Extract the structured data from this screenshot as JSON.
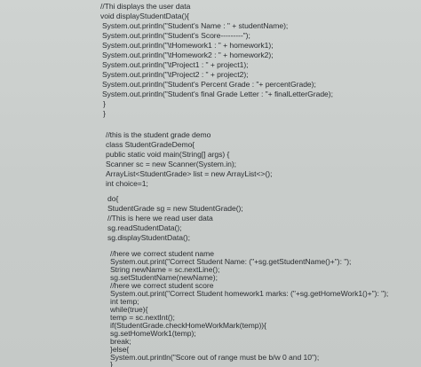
{
  "document": {
    "block1": [
      "//Thi displays the user data",
      "void displayStudentData(){",
      "System.out.println(\"Student's Name : \" + studentName);",
      "System.out.println(\"Student's Score---------\");",
      "System.out.println(\"\\tHomework1 : \" + homework1);",
      "System.out.println(\"\\tHomework2 : \" + homework2);",
      "System.out.println(\"\\tProject1 : \" + project1);",
      "System.out.println(\"\\tProject2 : \" + project2);",
      "System.out.println(\"Student's Percent Grade : \"+ percentGrade);",
      "System.out.println(\"Student's final Grade Letter : \"+ finalLetterGrade);",
      "}",
      "}"
    ],
    "block2": [
      "//this is the student grade demo",
      "class StudentGradeDemo{",
      "public static void main(String[] args) {",
      "Scanner sc = new Scanner(System.in);",
      "ArrayList<StudentGrade> list = new ArrayList<>();",
      "int choice=1;"
    ],
    "block3": [
      "do{",
      "StudentGrade sg = new StudentGrade();",
      "//This is here we read user data",
      "sg.readStudentData();",
      "sg.displayStudentData();"
    ],
    "block4": [
      "//here we correct student name",
      "System.out.print(\"Correct Student Name: (\"+sg.getStudentName()+\"): \");",
      "String newName = sc.nextLine();",
      "sg.setStudentName(newName);",
      "//here we correct student score",
      "System.out.print(\"Correct Student homework1 marks: (\"+sg.getHomeWork1()+\"): \");",
      "int temp;",
      "while(true){",
      "temp = sc.nextInt();",
      "if(StudentGrade.checkHomeWorkMark(temp)){",
      "sg.setHomeWork1(temp);",
      "break;",
      "}else{",
      "System.out.println(\"Score out of range must be b/w 0 and 10\");",
      "}"
    ]
  }
}
